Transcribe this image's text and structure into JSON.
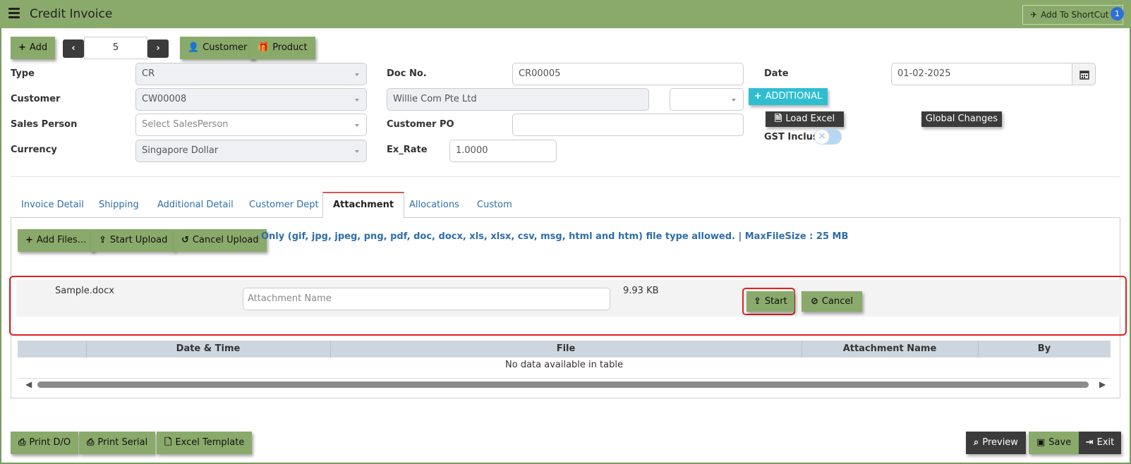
{
  "header": {
    "title": "Credit Invoice",
    "shortcut_label": "Add To ShortCut",
    "shortcut_badge": "1"
  },
  "toolbar": {
    "add_label": "Add",
    "record_number": "5",
    "customer_label": "Customer",
    "product_label": "Product"
  },
  "form": {
    "type_label": "Type",
    "type_value": "CR",
    "customer_label": "Customer",
    "customer_value": "CW00008",
    "sales_person_label": "Sales Person",
    "sales_person_placeholder": "Select SalesPerson",
    "currency_label": "Currency",
    "currency_value": "Singapore Dollar",
    "doc_no_label": "Doc No.",
    "doc_no_value": "CR00005",
    "customer_name_value": "Willie Com Pte Ltd",
    "customer_po_label": "Customer PO",
    "customer_po_value": "",
    "ex_rate_label": "Ex_Rate",
    "ex_rate_value": "1.0000",
    "date_label": "Date",
    "date_value": "01-02-2025",
    "additional_label": "ADDITIONAL",
    "load_excel_label": "Load Excel",
    "global_changes_label": "Global Changes",
    "gst_inclusive_label": "GST Inclusive",
    "gst_inclusive_on": false
  },
  "tabs": [
    {
      "label": "Invoice Detail"
    },
    {
      "label": "Shipping"
    },
    {
      "label": "Additional Detail"
    },
    {
      "label": "Customer Dept"
    },
    {
      "label": "Attachment",
      "active": true
    },
    {
      "label": "Allocations"
    },
    {
      "label": "Custom"
    }
  ],
  "attachment": {
    "add_files_label": "Add Files...",
    "start_upload_label": "Start Upload",
    "cancel_upload_label": "Cancel Upload",
    "allowed_note": "Only (gif, jpg, jpeg, png, pdf, doc, docx, xls, xlsx, csv, msg, html and htm) file type allowed. | MaxFileSize : 25 MB",
    "pending_file": {
      "name": "Sample.docx",
      "attachment_name_placeholder": "Attachment Name",
      "size": "9.93 KB",
      "start_label": "Start",
      "cancel_label": "Cancel"
    },
    "table": {
      "columns": [
        "Date & Time",
        "File",
        "Attachment Name",
        "By"
      ],
      "empty_message": "No data available in table"
    }
  },
  "footer": {
    "print_do_label": "Print D/O",
    "print_serial_label": "Print Serial",
    "excel_template_label": "Excel Template",
    "preview_label": "Preview",
    "save_label": "Save",
    "exit_label": "Exit"
  },
  "colors": {
    "header_bg": "#8aaa6b",
    "button_green": "#8aaa6b",
    "button_dark": "#3b3b3b",
    "additional_cyan": "#2ebed0",
    "link_blue": "#2f6ea8",
    "highlight_red": "#e02020"
  }
}
